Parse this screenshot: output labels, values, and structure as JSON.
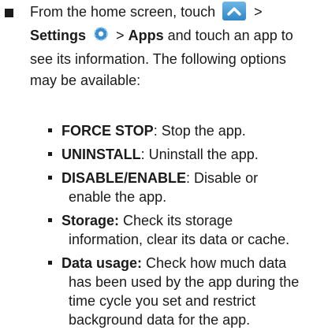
{
  "intro": {
    "line1": "From the home screen, touch",
    "line1_after": ">",
    "settings_label": "Settings",
    "sep1": ">",
    "apps_label": "Apps",
    "line2_rest": "and touch an app to",
    "line3": "see its information. The following options",
    "line4": "may be available:"
  },
  "options": [
    {
      "term": "FORCE STOP",
      "sep": ":",
      "desc_first": " Stop the app.",
      "desc_rest": ""
    },
    {
      "term": "UNINSTALL",
      "sep": ":",
      "desc_first": " Uninstall the app.",
      "desc_rest": ""
    },
    {
      "term": "DISABLE/ENABLE",
      "sep": ":",
      "desc_first": " Disable or",
      "desc_rest": "enable the app."
    },
    {
      "term": "Storage:",
      "sep": "",
      "desc_first": " Check its storage",
      "desc_rest": "information, clear its data or cache."
    },
    {
      "term": "Data usage:",
      "sep": "",
      "desc_first": " Check how much data",
      "desc_rest": "has been used by the app during the time cycle you set and restrict background data for the app."
    }
  ],
  "icons": {
    "home_up": "chevron-up-icon",
    "settings": "gear-icon"
  },
  "colors": {
    "icon_blue_light": "#6fb7e6",
    "icon_blue_dark": "#2f86c6",
    "text": "#1a1a1a"
  }
}
